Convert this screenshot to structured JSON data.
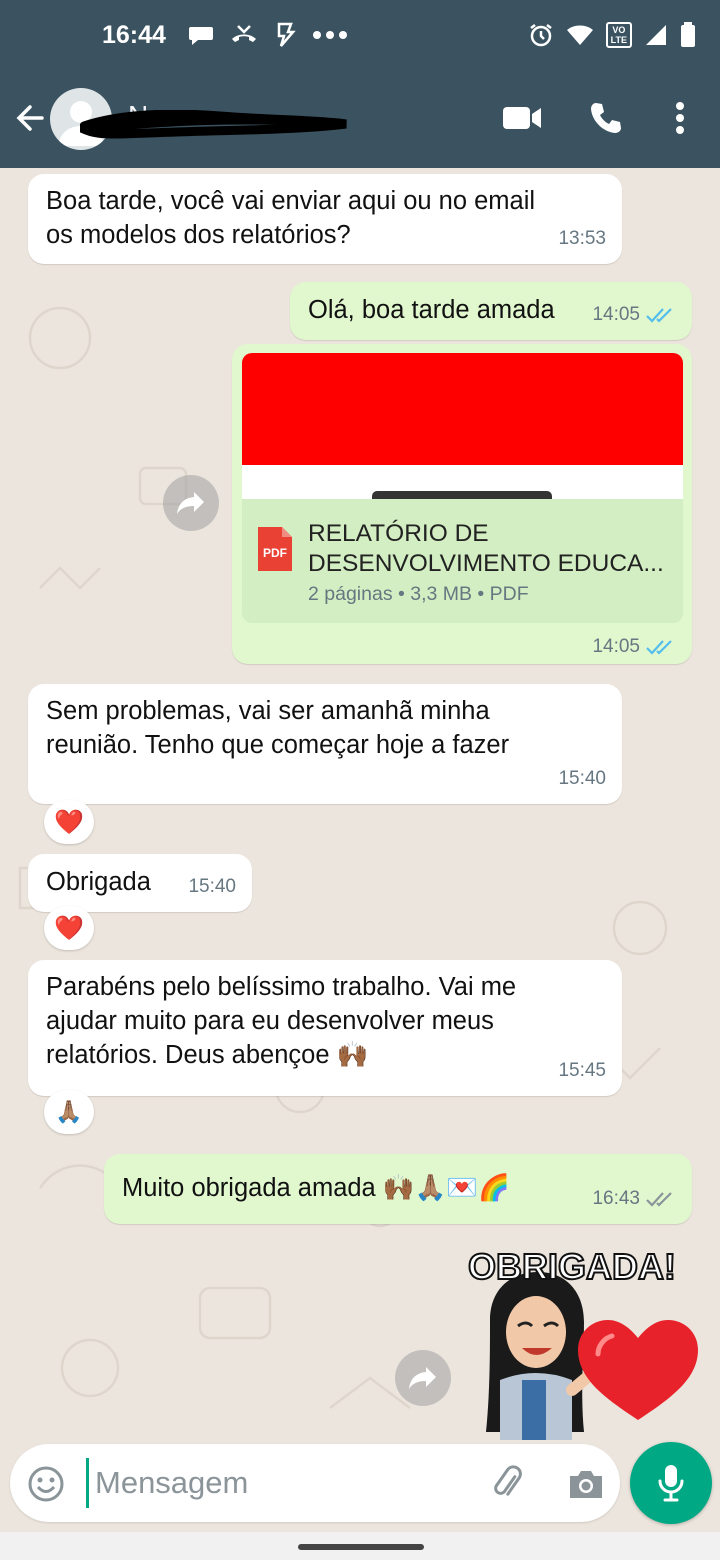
{
  "status_bar": {
    "time": "16:44",
    "lte_label_top": "VO",
    "lte_label_bottom": "LTE"
  },
  "header": {
    "contact_name": "N..."
  },
  "messages": [
    {
      "id": "m1",
      "direction": "in",
      "lines": [
        "Boa tarde, você vai enviar aqui ou no email",
        "os modelos dos relatórios?"
      ],
      "time": "13:53"
    },
    {
      "id": "m2",
      "direction": "out",
      "text": "Olá, boa tarde amada",
      "time": "14:05",
      "status": "read"
    },
    {
      "id": "m3",
      "direction": "out",
      "type": "document",
      "file_title_line1": "RELATÓRIO DE",
      "file_title_line2": "DESENVOLVIMENTO EDUCA...",
      "file_meta": "2 páginas • 3,3 MB • PDF",
      "file_badge": "PDF",
      "time": "14:05",
      "status": "read"
    },
    {
      "id": "m4",
      "direction": "in",
      "lines": [
        "Sem problemas, vai ser amanhã minha",
        "reunião. Tenho que começar hoje a fazer"
      ],
      "time": "15:40",
      "reaction": "❤️"
    },
    {
      "id": "m5",
      "direction": "in",
      "text": "Obrigada",
      "time": "15:40",
      "reaction": "❤️"
    },
    {
      "id": "m6",
      "direction": "in",
      "lines": [
        "Parabéns pelo belíssimo trabalho. Vai me",
        "ajudar muito para eu desenvolver meus",
        "relatórios. Deus abençoe 🙌🏾"
      ],
      "time": "15:45",
      "reaction": "🙏🏽"
    },
    {
      "id": "m7",
      "direction": "out",
      "text": "Muito obrigada amada 🙌🏾🙏🏽💌🌈",
      "time": "16:43",
      "status": "delivered"
    },
    {
      "id": "m8",
      "direction": "out",
      "type": "sticker",
      "caption": "OBRIGADA!"
    }
  ],
  "input": {
    "placeholder": "Mensagem"
  },
  "colors": {
    "header": "#3b5361",
    "incoming": "#ffffff",
    "outgoing": "#e1f8cf",
    "accent": "#00a884",
    "read_ticks": "#53bdeb",
    "delivered_ticks": "#8a9499"
  },
  "icons": [
    "back-arrow-icon",
    "video-call-icon",
    "voice-call-icon",
    "more-options-icon",
    "forward-icon",
    "pdf-icon",
    "emoji-icon",
    "attach-icon",
    "camera-icon",
    "mic-icon"
  ]
}
